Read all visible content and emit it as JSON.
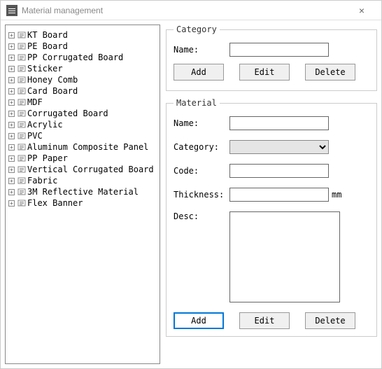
{
  "window": {
    "title": "Material management"
  },
  "tree": {
    "items": [
      {
        "label": "KT Board"
      },
      {
        "label": "PE Board"
      },
      {
        "label": "PP Corrugated Board"
      },
      {
        "label": "Sticker"
      },
      {
        "label": "Honey Comb"
      },
      {
        "label": "Card Board"
      },
      {
        "label": "MDF"
      },
      {
        "label": "Corrugated Board"
      },
      {
        "label": "Acrylic"
      },
      {
        "label": "PVC"
      },
      {
        "label": "Aluminum Composite Panel"
      },
      {
        "label": "PP Paper"
      },
      {
        "label": "Vertical Corrugated Board"
      },
      {
        "label": "Fabric"
      },
      {
        "label": "3M Reflective Material"
      },
      {
        "label": "Flex Banner"
      }
    ]
  },
  "category": {
    "legend": "Category",
    "name_label": "Name:",
    "name_value": "",
    "add": "Add",
    "edit": "Edit",
    "delete": "Delete"
  },
  "material": {
    "legend": "Material",
    "name_label": "Name:",
    "name_value": "",
    "category_label": "Category:",
    "category_value": "",
    "code_label": "Code:",
    "code_value": "",
    "thickness_label": "Thickness:",
    "thickness_value": "",
    "thickness_unit": "mm",
    "desc_label": "Desc:",
    "desc_value": "",
    "add": "Add",
    "edit": "Edit",
    "delete": "Delete"
  }
}
